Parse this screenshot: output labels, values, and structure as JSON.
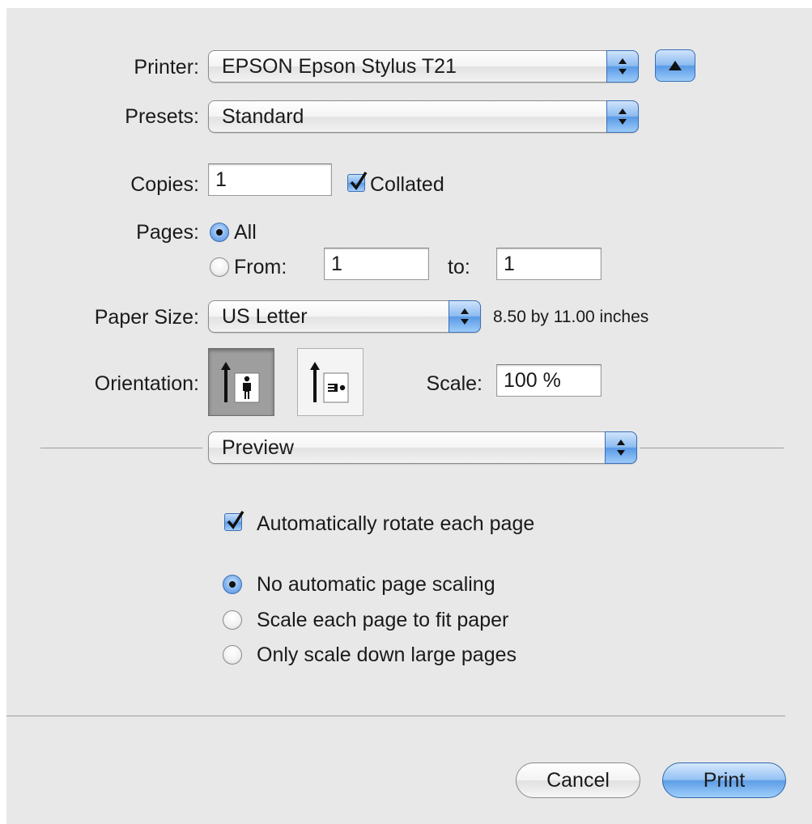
{
  "printer": {
    "label": "Printer:",
    "value": "EPSON Epson Stylus T21"
  },
  "presets": {
    "label": "Presets:",
    "value": "Standard"
  },
  "copies": {
    "label": "Copies:",
    "value": "1",
    "collated_label": "Collated",
    "collated": true
  },
  "pages": {
    "label": "Pages:",
    "all_label": "All",
    "from_label": "From:",
    "from_value": "1",
    "to_label": "to:",
    "to_value": "1",
    "selected": "all"
  },
  "paper_size": {
    "label": "Paper Size:",
    "value": "US Letter",
    "dimensions": "8.50 by 11.00 inches"
  },
  "orientation": {
    "label": "Orientation:",
    "selected": "portrait"
  },
  "scale": {
    "label": "Scale:",
    "value": "100 %"
  },
  "section": {
    "value": "Preview"
  },
  "preview": {
    "auto_rotate_label": "Automatically rotate each page",
    "auto_rotate": true,
    "scaling_options": [
      "No automatic page scaling",
      "Scale each page to fit paper",
      "Only scale down large pages"
    ],
    "scaling_selected": 0
  },
  "buttons": {
    "cancel": "Cancel",
    "print": "Print"
  },
  "colors": {
    "background": "#e8e8e8",
    "accent": "#5a9ae6"
  },
  "icons": {
    "disclosure": "triangle-up-icon",
    "popup": "up-down-arrows-icon"
  }
}
